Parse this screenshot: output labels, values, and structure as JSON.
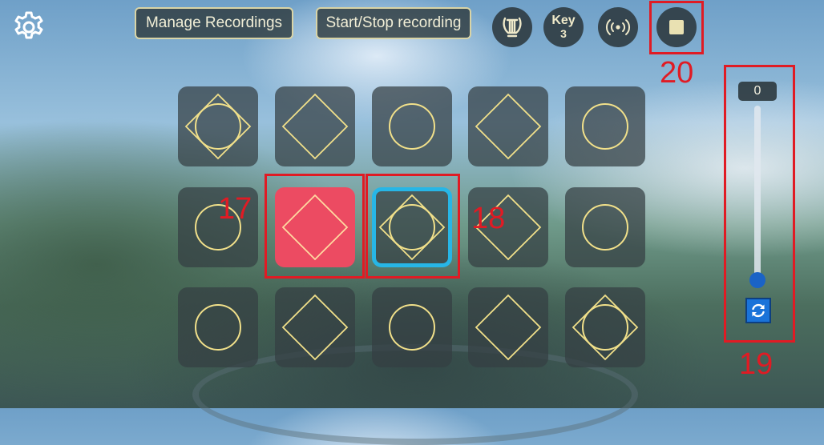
{
  "toolbar": {
    "settings_icon": "gear-icon",
    "manage_recordings_label": "Manage Recordings",
    "start_stop_recording_label": "Start/Stop recording",
    "instrument_icon": "lyre-icon",
    "key_label": "Key",
    "key_value": "3",
    "broadcast_icon": "broadcast-icon",
    "stop_icon": "stop-icon"
  },
  "grid": {
    "tiles": [
      {
        "shape": "diamond-circle",
        "state": "normal"
      },
      {
        "shape": "diamond",
        "state": "normal"
      },
      {
        "shape": "circle",
        "state": "normal"
      },
      {
        "shape": "diamond",
        "state": "normal"
      },
      {
        "shape": "circle",
        "state": "normal"
      },
      {
        "shape": "circle",
        "state": "normal"
      },
      {
        "shape": "diamond",
        "state": "active"
      },
      {
        "shape": "diamond-circle",
        "state": "selected"
      },
      {
        "shape": "diamond",
        "state": "normal"
      },
      {
        "shape": "circle",
        "state": "normal"
      },
      {
        "shape": "circle",
        "state": "normal"
      },
      {
        "shape": "diamond",
        "state": "normal"
      },
      {
        "shape": "circle",
        "state": "normal"
      },
      {
        "shape": "diamond",
        "state": "normal"
      },
      {
        "shape": "diamond-circle",
        "state": "normal"
      }
    ]
  },
  "slider": {
    "value_label": "0",
    "level": 0,
    "reset_icon": "refresh-icon"
  },
  "annotations": {
    "label_17": "17",
    "label_18": "18",
    "label_19": "19",
    "label_20": "20"
  },
  "colors": {
    "tile_bg": "#343e42",
    "tile_active": "#ec4b62",
    "tile_selected_border": "#27b6e6",
    "glyph_gold": "#f1e08a",
    "annotation_red": "#e01b24",
    "slider_thumb": "#1a63c6"
  }
}
